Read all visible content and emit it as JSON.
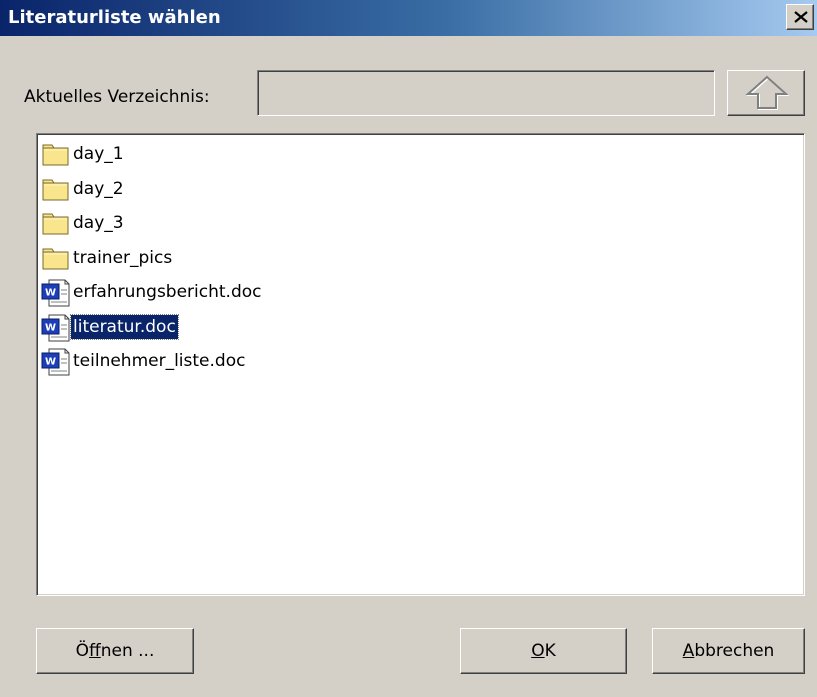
{
  "dialog": {
    "title": "Literaturliste wählen",
    "close_label": "×"
  },
  "directory": {
    "label": "Aktuelles Verzeichnis:",
    "value": ""
  },
  "files": [
    {
      "name": "day_1",
      "type": "folder",
      "selected": false
    },
    {
      "name": "day_2",
      "type": "folder",
      "selected": false
    },
    {
      "name": "day_3",
      "type": "folder",
      "selected": false
    },
    {
      "name": "trainer_pics",
      "type": "folder",
      "selected": false
    },
    {
      "name": "erfahrungsbericht.doc",
      "type": "word-doc",
      "selected": false
    },
    {
      "name": "literatur.doc",
      "type": "word-doc",
      "selected": true
    },
    {
      "name": "teilnehmer_liste.doc",
      "type": "word-doc",
      "selected": false
    }
  ],
  "buttons": {
    "open": {
      "pre": "Ö",
      "accel": "f",
      "post": "fnen ..."
    },
    "ok": {
      "pre": "",
      "accel": "O",
      "post": "K"
    },
    "cancel": {
      "pre": "",
      "accel": "A",
      "post": "bbrechen"
    }
  },
  "icons": {
    "folder": "folder-icon",
    "word_doc": "word-document-icon",
    "up": "up-arrow-icon",
    "close": "close-icon"
  },
  "colors": {
    "title_start": "#0a246a",
    "title_end": "#a6caf0",
    "selection": "#0a246a",
    "folder_fill": "#f8e58c",
    "word_blue": "#1c3fb8"
  }
}
